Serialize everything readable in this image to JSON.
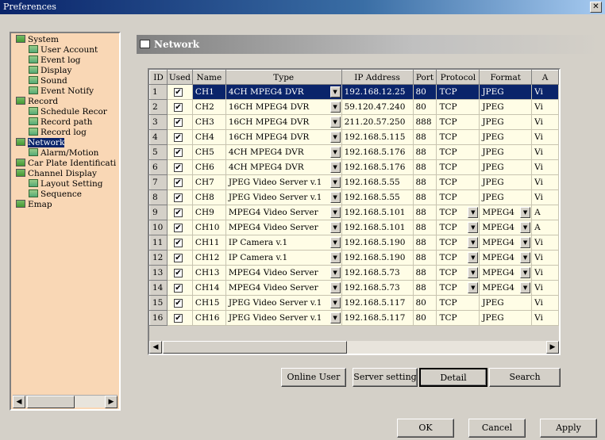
{
  "window": {
    "title": "Preferences",
    "close_glyph": "✕"
  },
  "tree": [
    {
      "label": "System",
      "level": 0,
      "type": "folder",
      "selected": false
    },
    {
      "label": "User Account",
      "level": 1,
      "type": "leaf",
      "selected": false
    },
    {
      "label": "Event log",
      "level": 1,
      "type": "leaf",
      "selected": false
    },
    {
      "label": "Display",
      "level": 1,
      "type": "leaf",
      "selected": false
    },
    {
      "label": "Sound",
      "level": 1,
      "type": "leaf",
      "selected": false
    },
    {
      "label": "Event Notify",
      "level": 1,
      "type": "leaf",
      "selected": false
    },
    {
      "label": "Record",
      "level": 0,
      "type": "folder",
      "selected": false
    },
    {
      "label": "Schedule Recor",
      "level": 1,
      "type": "leaf",
      "selected": false
    },
    {
      "label": "Record path",
      "level": 1,
      "type": "leaf",
      "selected": false
    },
    {
      "label": "Record log",
      "level": 1,
      "type": "leaf",
      "selected": false
    },
    {
      "label": "Network",
      "level": 0,
      "type": "folder",
      "selected": true
    },
    {
      "label": "Alarm/Motion",
      "level": 1,
      "type": "leaf",
      "selected": false
    },
    {
      "label": "Car Plate Identificati",
      "level": 0,
      "type": "folder",
      "selected": false
    },
    {
      "label": "Channel Display",
      "level": 0,
      "type": "folder",
      "selected": false
    },
    {
      "label": "Layout Setting",
      "level": 1,
      "type": "leaf",
      "selected": false
    },
    {
      "label": "Sequence",
      "level": 1,
      "type": "leaf",
      "selected": false
    },
    {
      "label": "Emap",
      "level": 0,
      "type": "folder",
      "selected": false
    }
  ],
  "panel": {
    "title": "Network"
  },
  "grid": {
    "columns": [
      "ID",
      "Used",
      "Name",
      "Type",
      "IP Address",
      "Port",
      "Protocol",
      "Format",
      "A"
    ],
    "rows": [
      {
        "id": "1",
        "used": true,
        "name": "CH1",
        "type": "4CH MPEG4 DVR",
        "ip": "192.168.12.25",
        "port": "80",
        "protocol": "TCP",
        "proto_dd": false,
        "format": "JPEG",
        "format_dd": false,
        "a": "Vi",
        "selected": true
      },
      {
        "id": "2",
        "used": true,
        "name": "CH2",
        "type": "16CH MPEG4 DVR",
        "ip": "59.120.47.240",
        "port": "80",
        "protocol": "TCP",
        "proto_dd": false,
        "format": "JPEG",
        "format_dd": false,
        "a": "Vi",
        "selected": false
      },
      {
        "id": "3",
        "used": true,
        "name": "CH3",
        "type": "16CH MPEG4 DVR",
        "ip": "211.20.57.250",
        "port": "888",
        "protocol": "TCP",
        "proto_dd": false,
        "format": "JPEG",
        "format_dd": false,
        "a": "Vi",
        "selected": false
      },
      {
        "id": "4",
        "used": true,
        "name": "CH4",
        "type": "16CH MPEG4 DVR",
        "ip": "192.168.5.115",
        "port": "88",
        "protocol": "TCP",
        "proto_dd": false,
        "format": "JPEG",
        "format_dd": false,
        "a": "Vi",
        "selected": false
      },
      {
        "id": "5",
        "used": true,
        "name": "CH5",
        "type": "4CH MPEG4 DVR",
        "ip": "192.168.5.176",
        "port": "88",
        "protocol": "TCP",
        "proto_dd": false,
        "format": "JPEG",
        "format_dd": false,
        "a": "Vi",
        "selected": false
      },
      {
        "id": "6",
        "used": true,
        "name": "CH6",
        "type": "4CH MPEG4 DVR",
        "ip": "192.168.5.176",
        "port": "88",
        "protocol": "TCP",
        "proto_dd": false,
        "format": "JPEG",
        "format_dd": false,
        "a": "Vi",
        "selected": false
      },
      {
        "id": "7",
        "used": true,
        "name": "CH7",
        "type": "JPEG Video Server v.1",
        "ip": "192.168.5.55",
        "port": "88",
        "protocol": "TCP",
        "proto_dd": false,
        "format": "JPEG",
        "format_dd": false,
        "a": "Vi",
        "selected": false
      },
      {
        "id": "8",
        "used": true,
        "name": "CH8",
        "type": "JPEG Video Server v.1",
        "ip": "192.168.5.55",
        "port": "88",
        "protocol": "TCP",
        "proto_dd": false,
        "format": "JPEG",
        "format_dd": false,
        "a": "Vi",
        "selected": false
      },
      {
        "id": "9",
        "used": true,
        "name": "CH9",
        "type": "MPEG4 Video Server",
        "ip": "192.168.5.101",
        "port": "88",
        "protocol": "TCP",
        "proto_dd": true,
        "format": "MPEG4",
        "format_dd": true,
        "a": "A",
        "selected": false
      },
      {
        "id": "10",
        "used": true,
        "name": "CH10",
        "type": "MPEG4 Video Server",
        "ip": "192.168.5.101",
        "port": "88",
        "protocol": "TCP",
        "proto_dd": true,
        "format": "MPEG4",
        "format_dd": true,
        "a": "A",
        "selected": false
      },
      {
        "id": "11",
        "used": true,
        "name": "CH11",
        "type": "IP Camera v.1",
        "ip": "192.168.5.190",
        "port": "88",
        "protocol": "TCP",
        "proto_dd": true,
        "format": "MPEG4",
        "format_dd": true,
        "a": "Vi",
        "selected": false
      },
      {
        "id": "12",
        "used": true,
        "name": "CH12",
        "type": "IP Camera v.1",
        "ip": "192.168.5.190",
        "port": "88",
        "protocol": "TCP",
        "proto_dd": true,
        "format": "MPEG4",
        "format_dd": true,
        "a": "Vi",
        "selected": false
      },
      {
        "id": "13",
        "used": true,
        "name": "CH13",
        "type": "MPEG4 Video Server",
        "ip": "192.168.5.73",
        "port": "88",
        "protocol": "TCP",
        "proto_dd": true,
        "format": "MPEG4",
        "format_dd": true,
        "a": "Vi",
        "selected": false
      },
      {
        "id": "14",
        "used": true,
        "name": "CH14",
        "type": "MPEG4 Video Server",
        "ip": "192.168.5.73",
        "port": "88",
        "protocol": "TCP",
        "proto_dd": true,
        "format": "MPEG4",
        "format_dd": true,
        "a": "Vi",
        "selected": false
      },
      {
        "id": "15",
        "used": true,
        "name": "CH15",
        "type": "JPEG Video Server v.1",
        "ip": "192.168.5.117",
        "port": "80",
        "protocol": "TCP",
        "proto_dd": false,
        "format": "JPEG",
        "format_dd": false,
        "a": "Vi",
        "selected": false
      },
      {
        "id": "16",
        "used": true,
        "name": "CH16",
        "type": "JPEG Video Server v.1",
        "ip": "192.168.5.117",
        "port": "80",
        "protocol": "TCP",
        "proto_dd": false,
        "format": "JPEG",
        "format_dd": false,
        "a": "Vi",
        "selected": false
      }
    ]
  },
  "panel_buttons": {
    "online_user": "Online User",
    "server_setting": "Server setting",
    "detail": "Detail",
    "search": "Search"
  },
  "dialog_buttons": {
    "ok": "OK",
    "cancel": "Cancel",
    "apply": "Apply"
  },
  "glyphs": {
    "check": "✔",
    "dropdown": "▼",
    "left": "◀",
    "right": "▶"
  },
  "colors": {
    "selection": "#0a246a",
    "tree_bg": "#f9d7b5",
    "cell_bg": "#fffde6"
  }
}
